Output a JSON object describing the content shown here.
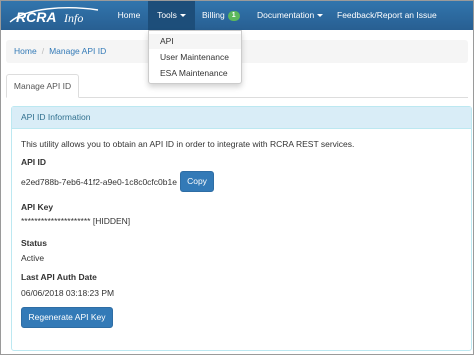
{
  "brand": {
    "logo_text": "RCRA",
    "logo_script": "Info"
  },
  "nav": {
    "home": "Home",
    "tools": "Tools",
    "billing": "Billing",
    "billing_badge": "1",
    "documentation": "Documentation",
    "feedback": "Feedback/Report an Issue"
  },
  "tools_menu": {
    "items": [
      "API",
      "User Maintenance",
      "ESA Maintenance"
    ]
  },
  "breadcrumb": {
    "home": "Home",
    "current": "Manage API ID"
  },
  "tab": {
    "label": "Manage API ID"
  },
  "panel": {
    "heading": "API ID Information",
    "description": "This utility allows you to obtain an API ID in order to integrate with RCRA REST services.",
    "api_id_label": "API ID",
    "api_id_value": "e2ed788b-7eb6-41f2-a9e0-1c8c0cfc0b1e",
    "copy_label": "Copy",
    "api_key_label": "API Key",
    "api_key_value": "********************* [HIDDEN]",
    "status_label": "Status",
    "status_value": "Active",
    "last_auth_label": "Last API Auth Date",
    "last_auth_value": "06/06/2018 03:18:23 PM",
    "regenerate_label": "Regenerate API Key"
  },
  "colors": {
    "navbar": "#2a6496",
    "primary_button": "#337ab7",
    "panel_heading": "#d9edf7",
    "badge": "#5cb85c"
  }
}
